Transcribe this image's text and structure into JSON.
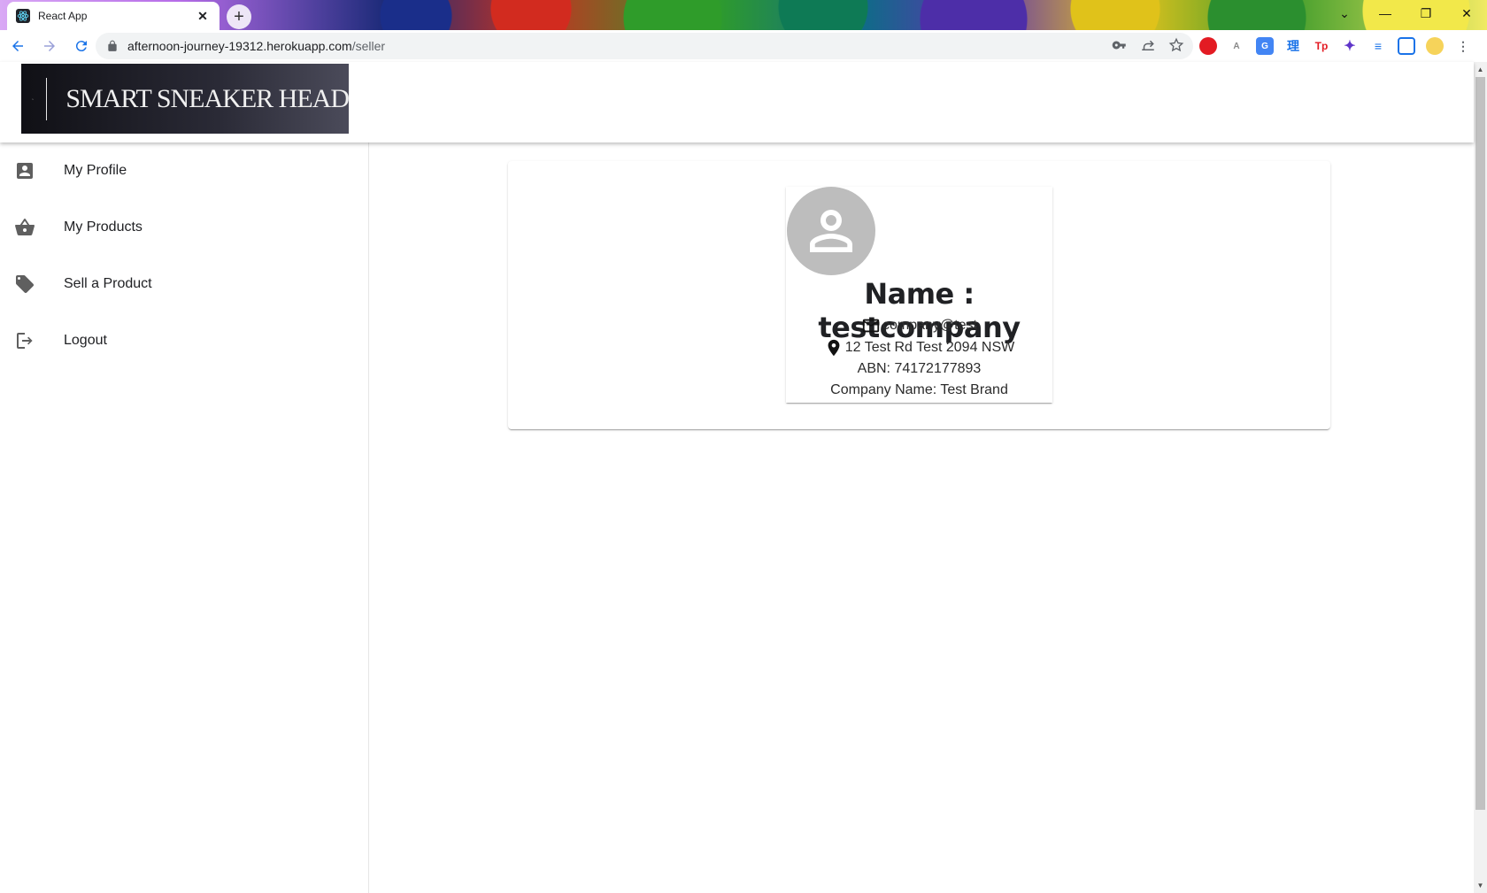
{
  "browser": {
    "tab_title": "React App",
    "tab_close": "✕",
    "new_tab": "+",
    "url_host": "afternoon-journey-19312.herokuapp.com",
    "url_path": "/seller",
    "window_controls": [
      "⌄",
      "—",
      "❐",
      "✕"
    ]
  },
  "brand": {
    "logo_text": "SMART SNEAKER HEAD"
  },
  "sidebar": {
    "items": [
      {
        "label": "My Profile",
        "icon": "account-box-icon"
      },
      {
        "label": "My Products",
        "icon": "shopping-basket-icon"
      },
      {
        "label": "Sell a Product",
        "icon": "tag-icon"
      },
      {
        "label": "Logout",
        "icon": "logout-icon"
      }
    ]
  },
  "profile": {
    "name_line": "Name : testcompany",
    "email": "company@test",
    "address": "12 Test Rd Test 2094 NSW",
    "abn_line": "ABN: 74172177893",
    "company_line": "Company Name: Test Brand"
  },
  "colors": {
    "avatar_bg": "#bdbdbd",
    "logo_bg": "#1a1a22",
    "sidebar_icon": "#5f5f5f"
  }
}
